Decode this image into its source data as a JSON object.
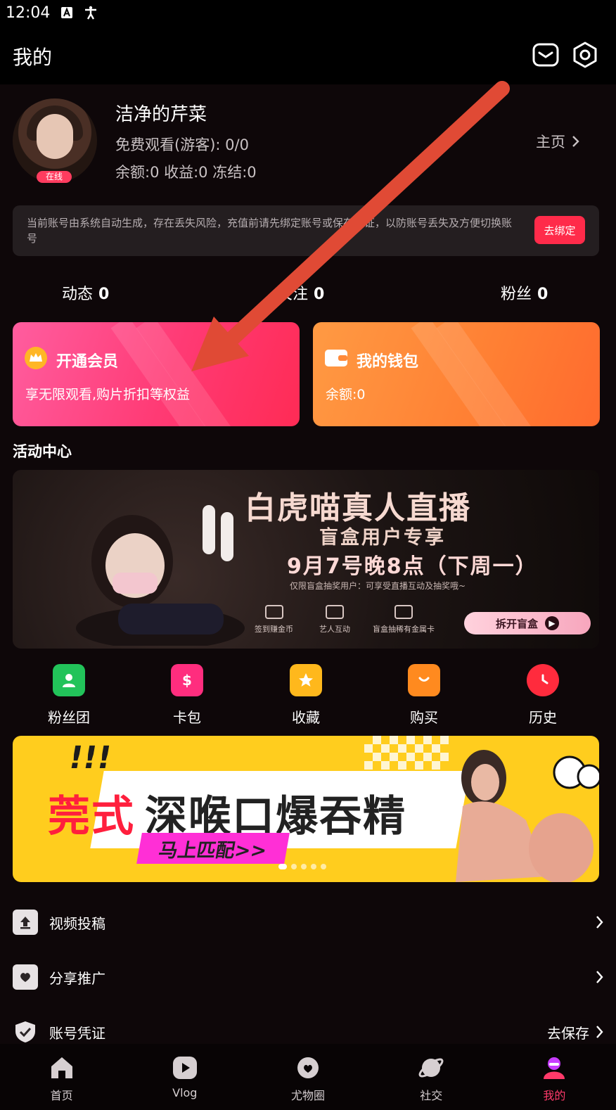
{
  "status_bar": {
    "time": "12:04",
    "icons": [
      "text-a-icon",
      "accessibility-icon"
    ]
  },
  "header": {
    "title": "我的",
    "icons": [
      "message-icon",
      "settings-icon"
    ]
  },
  "profile": {
    "username": "洁净的芹菜",
    "online_badge": "在线",
    "free_watch": "免费观看(游客): 0/0",
    "balance_line": "余额:0 收益:0 冻结:0",
    "homepage_link": "主页"
  },
  "notice": {
    "text": "当前账号由系统自动生成，存在丢失风险，充值前请先绑定账号或保存凭证，以防账号丢失及方便切换账号",
    "button": "去绑定"
  },
  "stats": [
    {
      "label": "动态",
      "value": "0"
    },
    {
      "label": "关注",
      "value": "0"
    },
    {
      "label": "粉丝",
      "value": "0"
    }
  ],
  "cards": {
    "vip": {
      "title": "开通会员",
      "subtitle": "享无限观看,购片折扣等权益",
      "icon": "crown-icon"
    },
    "wallet": {
      "title": "我的钱包",
      "subtitle": "余额:0",
      "icon": "wallet-icon"
    }
  },
  "activity_section": {
    "title": "活动中心"
  },
  "banner_live": {
    "title": "白虎喵真人直播",
    "subtitle": "盲盒用户专享",
    "date": "9月7号晚8点（下周一）",
    "note": "仅限盲盒抽奖用户：可享受直播互动及抽奖哦~",
    "features": [
      "签到赚金币",
      "艺人互动",
      "盲盒抽稀有金属卡"
    ],
    "button": "拆开盲盒"
  },
  "quick_links": [
    {
      "label": "粉丝团",
      "icon": "fan-group-icon",
      "color": "#22c35a"
    },
    {
      "label": "卡包",
      "icon": "card-wallet-icon",
      "color": "#ff2d7e"
    },
    {
      "label": "收藏",
      "icon": "favorite-star-icon",
      "color": "#ffb81c"
    },
    {
      "label": "购买",
      "icon": "shopping-bag-icon",
      "color": "#ff8a1f"
    },
    {
      "label": "历史",
      "icon": "history-clock-icon",
      "color": "#ff2b3d"
    }
  ],
  "banner_ad": {
    "exclaim": "!!!",
    "title_red": "莞式",
    "title_black": "深喉口爆吞精",
    "button": "马上匹配>>"
  },
  "menu": [
    {
      "label": "视频投稿",
      "icon": "upload-icon",
      "right": ""
    },
    {
      "label": "分享推广",
      "icon": "share-icon",
      "right": ""
    },
    {
      "label": "账号凭证",
      "icon": "shield-check-icon",
      "right": "去保存"
    }
  ],
  "bottom_nav": [
    {
      "label": "首页",
      "icon": "home-icon",
      "active": false
    },
    {
      "label": "Vlog",
      "icon": "play-icon",
      "active": false
    },
    {
      "label": "尤物圈",
      "icon": "heart-planet-icon",
      "active": false
    },
    {
      "label": "社交",
      "icon": "planet-icon",
      "active": false
    },
    {
      "label": "我的",
      "icon": "profile-icon",
      "active": true
    }
  ],
  "colors": {
    "accent": "#ff2b4a",
    "vip": "#ff3a74",
    "wallet": "#ff7f33",
    "nav_active": "#ff3a6a"
  }
}
